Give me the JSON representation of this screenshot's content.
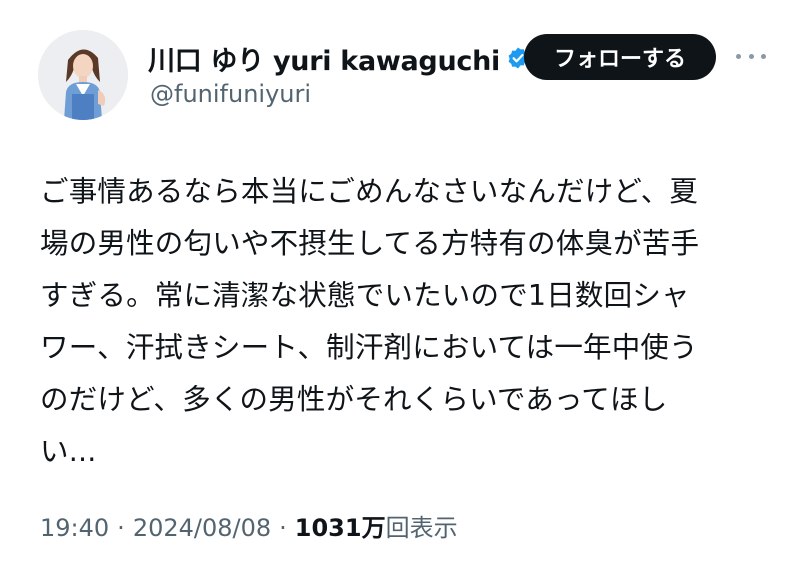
{
  "user": {
    "display_name": "川口 ゆり yuri kawaguchi",
    "handle": "@funifuniyuri",
    "verified_icon": "verified-badge-icon",
    "verified_color": "#1d9bf0"
  },
  "actions": {
    "follow_label": "フォローする",
    "more_icon": "more-horizontal-icon"
  },
  "tweet": {
    "lines": [
      "ご事情あるなら本当にごめんなさいなんだけど、夏",
      "場の男性の匂いや不摂生してる方特有の体臭が苦手",
      "すぎる。常に清潔な状態でいたいので1日数回シャ",
      "ワー、汗拭きシート、制汗剤においては一年中使う",
      "のだけど、多くの男性がそれくらいであってほし",
      "い..."
    ]
  },
  "meta": {
    "time": "19:40",
    "separator": "·",
    "date": "2024/08/08",
    "views_count": "1031万",
    "views_label": "回表示"
  },
  "colors": {
    "text": "#0f1419",
    "secondary": "#536471",
    "button_bg": "#0f1419",
    "button_text": "#ffffff"
  }
}
